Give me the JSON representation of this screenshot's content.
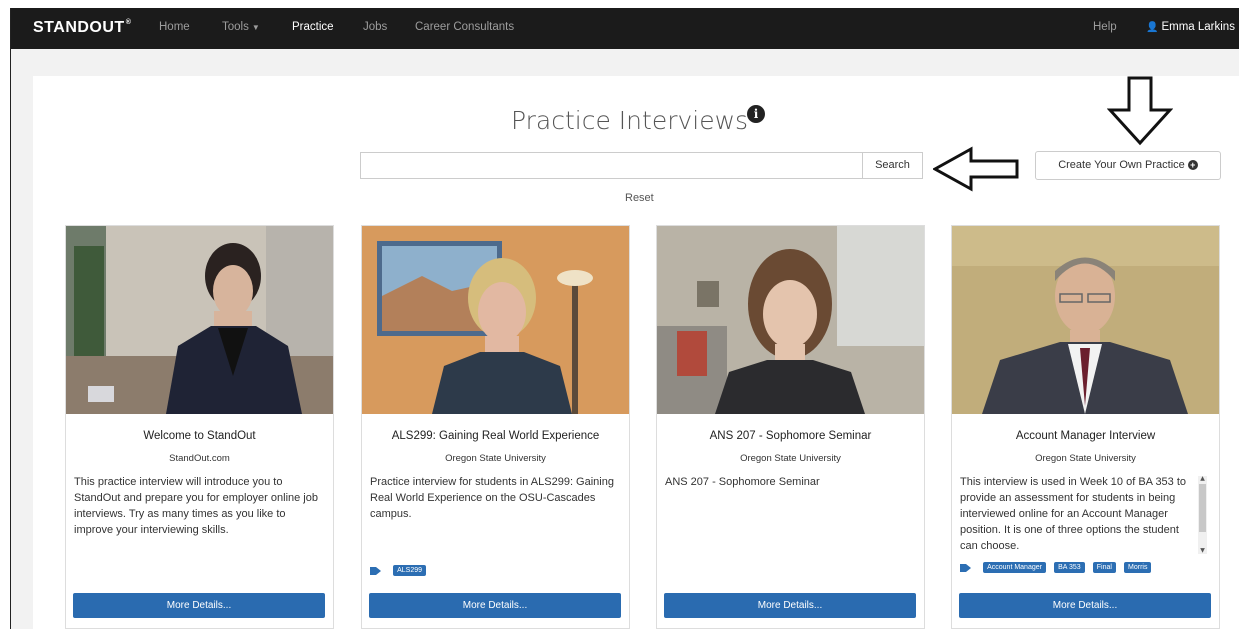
{
  "navbar": {
    "brand": "STANDOUT",
    "brand_mark": "®",
    "items": [
      {
        "label": "Home"
      },
      {
        "label": "Tools"
      },
      {
        "label": "Practice"
      },
      {
        "label": "Jobs"
      },
      {
        "label": "Career Consultants"
      }
    ],
    "help": "Help",
    "user": "Emma Larkins"
  },
  "page": {
    "title": "Practice Interviews",
    "search_button": "Search",
    "reset": "Reset",
    "create_button": "Create Your Own Practice"
  },
  "cards": [
    {
      "title": "Welcome to StandOut",
      "org": "StandOut.com",
      "description": "This practice interview will introduce you to StandOut and prepare you for employer online job interviews. Try as many times as you like to improve your interviewing skills.",
      "tags": [],
      "button": "More Details..."
    },
    {
      "title": "ALS299: Gaining Real World Experience",
      "org": "Oregon State University",
      "description": "Practice interview for students in ALS299: Gaining Real World Experience on the OSU-Cascades campus.",
      "tags": [
        "ALS299"
      ],
      "button": "More Details..."
    },
    {
      "title": "ANS 207 - Sophomore Seminar",
      "org": "Oregon State University",
      "description": "ANS 207 - Sophomore Seminar",
      "tags": [],
      "button": "More Details..."
    },
    {
      "title": "Account Manager Interview",
      "org": "Oregon State University",
      "description": "This interview is used in Week 10 of BA 353 to provide an assessment for students in being interviewed online for an Account Manager position. It is one of three options the student can choose.",
      "tags": [
        "Account Manager",
        "BA 353",
        "Final",
        "Morris"
      ],
      "button": "More Details..."
    }
  ],
  "colors": {
    "navbar": "#1b1b1b",
    "primary_button": "#2a6bb0",
    "tag": "#2c6eb3"
  }
}
